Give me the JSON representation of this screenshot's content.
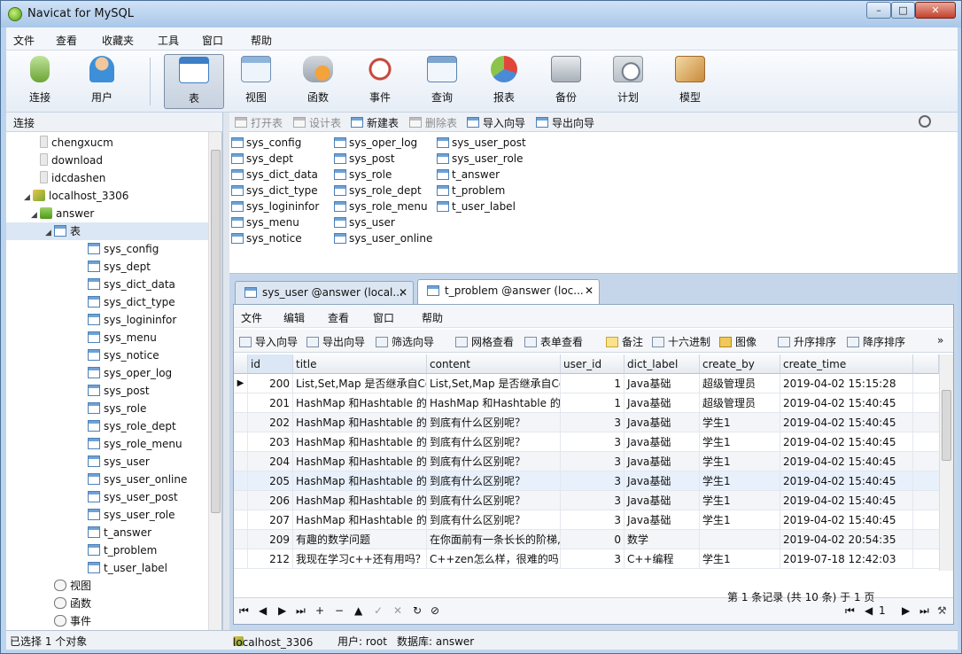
{
  "window": {
    "title": "Navicat for MySQL",
    "controls": {
      "minimize": "–",
      "maximize": "□",
      "close": "✕"
    }
  },
  "menubar": [
    "文件",
    "查看",
    "收藏夹",
    "工具",
    "窗口",
    "帮助"
  ],
  "ribbon": {
    "items": [
      {
        "label": "连接",
        "icon": "plug-icon",
        "active": false
      },
      {
        "label": "用户",
        "icon": "user-icon",
        "active": false
      },
      {
        "label": "表",
        "icon": "table-icon",
        "active": true
      },
      {
        "label": "视图",
        "icon": "view-icon",
        "active": false
      },
      {
        "label": "函数",
        "icon": "function-icon",
        "active": false
      },
      {
        "label": "事件",
        "icon": "event-clock-icon",
        "active": false
      },
      {
        "label": "查询",
        "icon": "query-icon",
        "active": false
      },
      {
        "label": "报表",
        "icon": "report-icon",
        "active": false
      },
      {
        "label": "备份",
        "icon": "backup-icon",
        "active": false
      },
      {
        "label": "计划",
        "icon": "schedule-icon",
        "active": false
      },
      {
        "label": "模型",
        "icon": "model-icon",
        "active": false
      }
    ]
  },
  "left": {
    "header": "连接",
    "tree": [
      {
        "label": "chengxucm",
        "level": 1,
        "icon": "db",
        "toggle": ""
      },
      {
        "label": "download",
        "level": 1,
        "icon": "db",
        "toggle": ""
      },
      {
        "label": "idcdashen",
        "level": 1,
        "icon": "db",
        "toggle": ""
      },
      {
        "label": "localhost_3306",
        "level": 0,
        "icon": "conn",
        "toggle": "◢"
      },
      {
        "label": "answer",
        "level": 1,
        "icon": "dbg",
        "toggle": "◢"
      },
      {
        "label": "表",
        "level": 2,
        "icon": "table",
        "toggle": "◢"
      },
      {
        "label": "sys_config",
        "level": 3,
        "icon": "table",
        "toggle": ""
      },
      {
        "label": "sys_dept",
        "level": 3,
        "icon": "table",
        "toggle": ""
      },
      {
        "label": "sys_dict_data",
        "level": 3,
        "icon": "table",
        "toggle": ""
      },
      {
        "label": "sys_dict_type",
        "level": 3,
        "icon": "table",
        "toggle": ""
      },
      {
        "label": "sys_logininfor",
        "level": 3,
        "icon": "table",
        "toggle": ""
      },
      {
        "label": "sys_menu",
        "level": 3,
        "icon": "table",
        "toggle": ""
      },
      {
        "label": "sys_notice",
        "level": 3,
        "icon": "table",
        "toggle": ""
      },
      {
        "label": "sys_oper_log",
        "level": 3,
        "icon": "table",
        "toggle": ""
      },
      {
        "label": "sys_post",
        "level": 3,
        "icon": "table",
        "toggle": ""
      },
      {
        "label": "sys_role",
        "level": 3,
        "icon": "table",
        "toggle": ""
      },
      {
        "label": "sys_role_dept",
        "level": 3,
        "icon": "table",
        "toggle": ""
      },
      {
        "label": "sys_role_menu",
        "level": 3,
        "icon": "table",
        "toggle": ""
      },
      {
        "label": "sys_user",
        "level": 3,
        "icon": "table",
        "toggle": ""
      },
      {
        "label": "sys_user_online",
        "level": 3,
        "icon": "table",
        "toggle": ""
      },
      {
        "label": "sys_user_post",
        "level": 3,
        "icon": "table",
        "toggle": ""
      },
      {
        "label": "sys_user_role",
        "level": 3,
        "icon": "table",
        "toggle": ""
      },
      {
        "label": "t_answer",
        "level": 3,
        "icon": "table",
        "toggle": ""
      },
      {
        "label": "t_problem",
        "level": 3,
        "icon": "table",
        "toggle": ""
      },
      {
        "label": "t_user_label",
        "level": 3,
        "icon": "table",
        "toggle": ""
      },
      {
        "label": "视图",
        "level": 2,
        "icon": "view",
        "toggle": ""
      },
      {
        "label": "函数",
        "level": 2,
        "icon": "func",
        "toggle": ""
      },
      {
        "label": "事件",
        "level": 2,
        "icon": "event",
        "toggle": ""
      }
    ]
  },
  "object_toolbar": {
    "open_table": "打开表",
    "design_table": "设计表",
    "new_table": "新建表",
    "delete_table": "删除表",
    "import_wizard": "导入向导",
    "export_wizard": "导出向导"
  },
  "objects": {
    "col1": [
      "sys_config",
      "sys_dept",
      "sys_dict_data",
      "sys_dict_type",
      "sys_logininfor",
      "sys_menu",
      "sys_notice"
    ],
    "col2": [
      "sys_oper_log",
      "sys_post",
      "sys_role",
      "sys_role_dept",
      "sys_role_menu",
      "sys_user",
      "sys_user_online"
    ],
    "col3": [
      "sys_user_post",
      "sys_user_role",
      "t_answer",
      "t_problem",
      "t_user_label"
    ]
  },
  "tabs": [
    {
      "label": "sys_user @answer (local...",
      "close": "✕"
    },
    {
      "label": "t_problem @answer (loc...",
      "close": "✕"
    }
  ],
  "inner_menu": [
    "文件",
    "编辑",
    "查看",
    "窗口",
    "帮助"
  ],
  "inner_toolbar": [
    "导入向导",
    "导出向导",
    "筛选向导",
    "网格查看",
    "表单查看",
    "备注",
    "十六进制",
    "图像",
    "升序排序",
    "降序排序"
  ],
  "grid": {
    "columns": [
      "id",
      "title",
      "content",
      "user_id",
      "dict_label",
      "create_by",
      "create_time"
    ],
    "rows": [
      [
        "200",
        "List,Set,Map 是否继承自Co",
        "List,Set,Map 是否继承自Co",
        "1",
        "Java基础",
        "超级管理员",
        "2019-04-02 15:15:28"
      ],
      [
        "201",
        "HashMap 和Hashtable 的",
        "HashMap 和Hashtable 的",
        "1",
        "Java基础",
        "超级管理员",
        "2019-04-02 15:40:45"
      ],
      [
        "202",
        "HashMap 和Hashtable 的",
        "到底有什么区别呢？",
        "3",
        "Java基础",
        "学生1",
        "2019-04-02 15:40:45"
      ],
      [
        "203",
        "HashMap 和Hashtable 的",
        "到底有什么区别呢？",
        "3",
        "Java基础",
        "学生1",
        "2019-04-02 15:40:45"
      ],
      [
        "204",
        "HashMap 和Hashtable 的",
        "到底有什么区别呢？",
        "3",
        "Java基础",
        "学生1",
        "2019-04-02 15:40:45"
      ],
      [
        "205",
        "HashMap 和Hashtable 的",
        "到底有什么区别呢？",
        "3",
        "Java基础",
        "学生1",
        "2019-04-02 15:40:45"
      ],
      [
        "206",
        "HashMap 和Hashtable 的",
        "到底有什么区别呢？",
        "3",
        "Java基础",
        "学生1",
        "2019-04-02 15:40:45"
      ],
      [
        "207",
        "HashMap 和Hashtable 的",
        "到底有什么区别呢？",
        "3",
        "Java基础",
        "学生1",
        "2019-04-02 15:40:45"
      ],
      [
        "209",
        "有趣的数学问题",
        "在你面前有一条长长的阶梯,",
        "0",
        "数学",
        "",
        "2019-04-02 20:54:35"
      ],
      [
        "212",
        "我现在学习c++还有用吗？",
        "C++zen怎么样，很难的吗",
        "3",
        "C++编程",
        "学生1",
        "2019-07-18 12:42:03"
      ]
    ]
  },
  "navbar": {
    "first": "⏮",
    "prev": "◀",
    "next": "▶",
    "last": "⏭",
    "add": "+",
    "remove": "−",
    "up": "▲",
    "apply": "✓",
    "discard": "✕",
    "refresh": "↻",
    "stop": "⊘",
    "page_number": "1"
  },
  "page_info": "第 1 条记录 (共 10 条) 于 1 页",
  "status": {
    "selection": "已选择 1 个对象",
    "connection": "localhost_3306",
    "user_label": "用户: root",
    "database_label": "数据库: answer"
  },
  "colors": {
    "accent": "#4d80b8",
    "selected_row": "#dbe7f5",
    "window_bg": "#bcd4ee"
  }
}
